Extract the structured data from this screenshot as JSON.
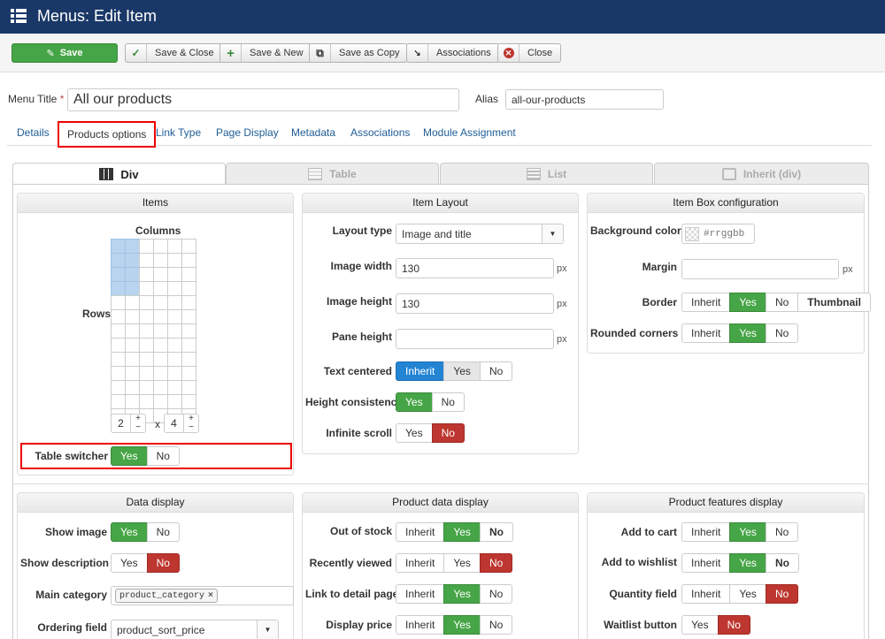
{
  "header": {
    "title": "Menus: Edit Item"
  },
  "toolbar": {
    "save": "Save",
    "save_close": "Save & Close",
    "save_new": "Save & New",
    "save_copy": "Save as Copy",
    "associations": "Associations",
    "close": "Close"
  },
  "form": {
    "menu_title_label": "Menu Title",
    "required_mark": "*",
    "menu_title_value": "All our products",
    "alias_label": "Alias",
    "alias_value": "all-our-products"
  },
  "tabs": [
    "Details",
    "Products options",
    "Link Type",
    "Page Display",
    "Metadata",
    "Associations",
    "Module Assignment"
  ],
  "active_tab": "Products options",
  "view_tabs": [
    "Div",
    "Table",
    "List",
    "Inherit (div)"
  ],
  "active_view_tab": "Div",
  "items_panel": {
    "title": "Items",
    "columns_label": "Columns",
    "rows_label": "Rows",
    "grid": {
      "cols": 6,
      "rows": 13,
      "selected_cols": 2,
      "selected_rows": 4
    },
    "cols_value": "2",
    "times": "x",
    "rows_value": "4",
    "table_switcher_label": "Table switcher",
    "table_switcher_options": [
      "Yes",
      "No"
    ],
    "table_switcher_value": "Yes"
  },
  "item_layout": {
    "title": "Item Layout",
    "layout_type_label": "Layout type",
    "layout_type_value": "Image and title",
    "image_width_label": "Image width",
    "image_width_value": "130",
    "image_height_label": "Image height",
    "image_height_value": "130",
    "pane_height_label": "Pane height",
    "pane_height_value": "",
    "unit": "px",
    "text_centered_label": "Text centered",
    "text_centered_options": [
      "Inherit",
      "Yes",
      "No"
    ],
    "height_consistency_label": "Height consistency",
    "height_consistency_options": [
      "Yes",
      "No"
    ],
    "infinite_scroll_label": "Infinite scroll",
    "infinite_scroll_options": [
      "Yes",
      "No"
    ]
  },
  "item_box": {
    "title": "Item Box configuration",
    "bg_color_label": "Background color",
    "bg_color_placeholder": "#rrggbb",
    "margin_label": "Margin",
    "margin_value": "",
    "unit": "px",
    "border_label": "Border",
    "border_options": [
      "Inherit",
      "Yes",
      "No",
      "Thumbnail"
    ],
    "rounded_label": "Rounded corners",
    "rounded_options": [
      "Inherit",
      "Yes",
      "No"
    ]
  },
  "data_display": {
    "title": "Data display",
    "show_image_label": "Show image",
    "show_image_options": [
      "Yes",
      "No"
    ],
    "show_description_label": "Show description",
    "show_description_options": [
      "Yes",
      "No"
    ],
    "main_category_label": "Main category",
    "main_category_chip": "product_category",
    "chip_remove": "×",
    "ordering_label": "Ordering field",
    "ordering_value": "product_sort_price"
  },
  "product_data": {
    "title": "Product data display",
    "out_of_stock_label": "Out of stock",
    "recently_viewed_label": "Recently viewed",
    "link_detail_label": "Link to detail page",
    "display_price_label": "Display price",
    "options": [
      "Inherit",
      "Yes",
      "No"
    ]
  },
  "product_features": {
    "title": "Product features display",
    "add_to_cart_label": "Add to cart",
    "add_to_wishlist_label": "Add to wishlist",
    "quantity_label": "Quantity field",
    "options": [
      "Inherit",
      "Yes",
      "No"
    ],
    "waitlist_label": "Waitlist button",
    "waitlist_options": [
      "Yes",
      "No"
    ]
  },
  "colors": {
    "header": "#1a3867",
    "green": "#46a546",
    "red": "#bd362f",
    "blue": "#2384d3",
    "highlight": "#e00"
  }
}
